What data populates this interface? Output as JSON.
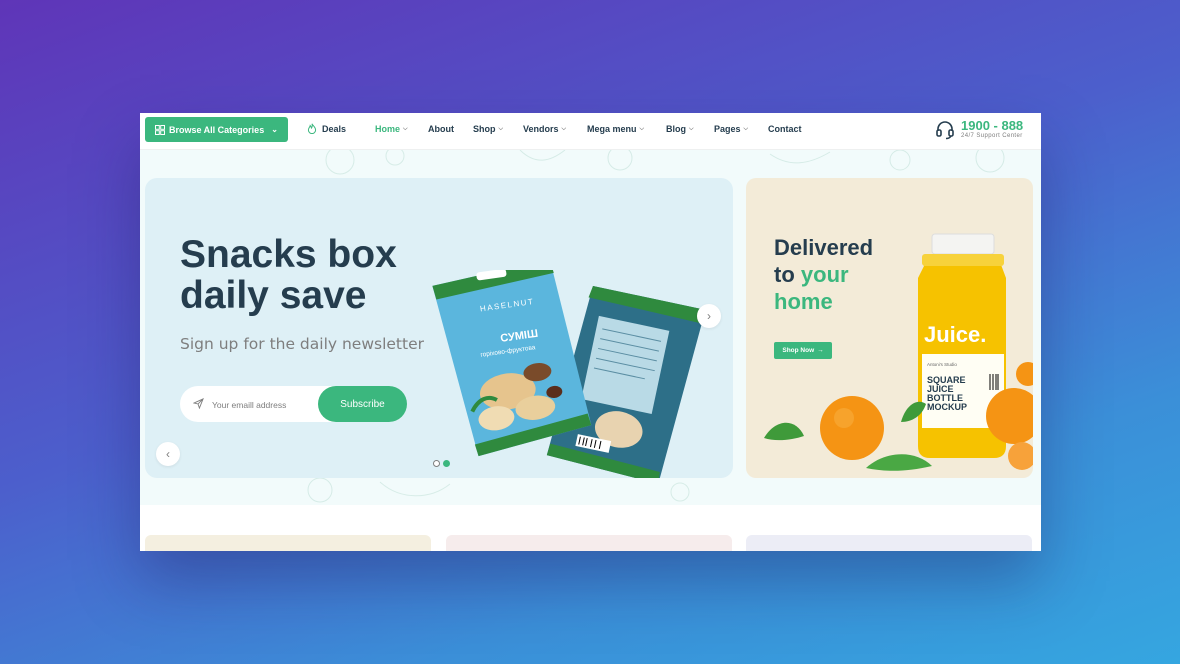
{
  "header": {
    "browse_label": "Browse All Categories",
    "deals_label": "Deals",
    "nav": [
      "Home",
      "About",
      "Shop",
      "Vendors",
      "Mega menu",
      "Blog",
      "Pages",
      "Contact"
    ],
    "support_phone": "1900 - 888",
    "support_label": "24/7 Support Center"
  },
  "hero": {
    "title_line1": "Snacks box",
    "title_line2": "daily save",
    "subtitle": "Sign up for the daily newsletter",
    "email_placeholder": "Your emaill address",
    "subscribe_label": "Subscribe",
    "active_slide": 2,
    "slide_count": 2,
    "product_pack": {
      "brand": "HASELNUT",
      "name": "СУМІШ",
      "tagline": "горіхово-фруктова"
    }
  },
  "promo": {
    "line1": "Delivered",
    "line2_a": "to",
    "line2_b": "your",
    "line3": "home",
    "shop_now_label": "Shop Now",
    "bottle_brand": "Juice.",
    "bottle_studio": "Antoni's Studio",
    "bottle_text": [
      "SQUARE",
      "JUICE",
      "BOTTLE",
      "MOCKUP"
    ]
  },
  "colors": {
    "brand_green": "#3bb77e",
    "heading": "#253d4e",
    "muted": "#7e7e7e"
  }
}
